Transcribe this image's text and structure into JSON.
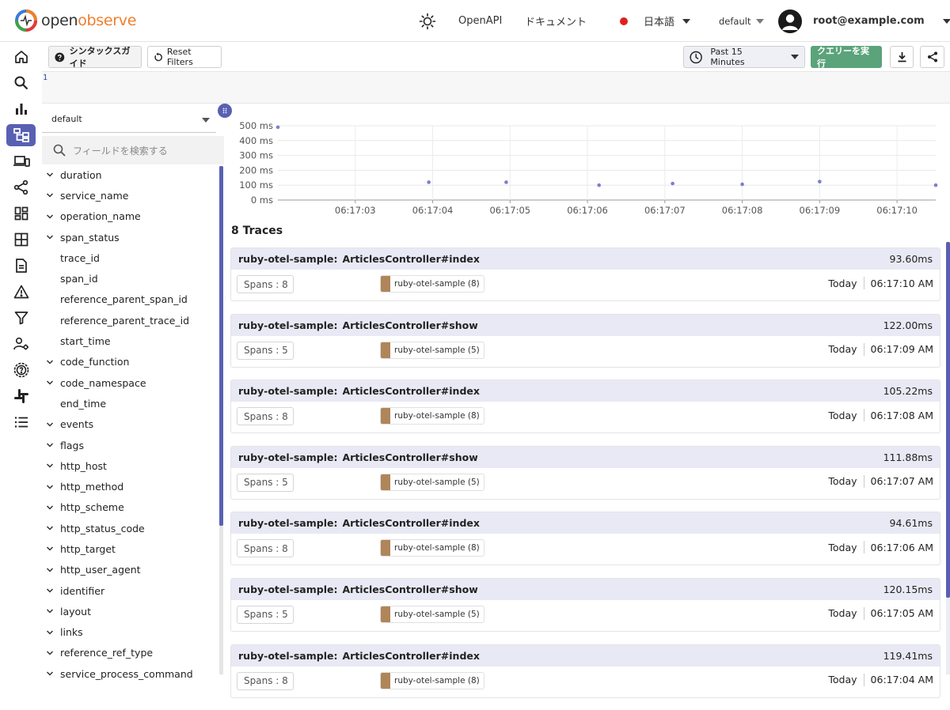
{
  "brand": {
    "logo_primary": "open",
    "logo_accent": "observe"
  },
  "header": {
    "openapi_label": "OpenAPI",
    "docs_label": "ドキュメント",
    "language_label": "日本語",
    "org_label": "default",
    "user_label": "root@example.com",
    "status_dot_color": "#e02020"
  },
  "sidenav": {
    "items": [
      {
        "name": "home-icon",
        "active": false
      },
      {
        "name": "search-icon",
        "active": false
      },
      {
        "name": "metrics-icon",
        "active": false
      },
      {
        "name": "traces-icon",
        "active": true
      },
      {
        "name": "rum-icon",
        "active": false
      },
      {
        "name": "pipeline-icon",
        "active": false
      },
      {
        "name": "dashboards-icon",
        "active": false
      },
      {
        "name": "streams-icon",
        "active": false
      },
      {
        "name": "reports-icon",
        "active": false
      },
      {
        "name": "alerts-icon",
        "active": false
      },
      {
        "name": "functions-icon",
        "active": false
      },
      {
        "name": "iam-icon",
        "active": false
      },
      {
        "name": "settings-icon",
        "active": false
      },
      {
        "name": "slack-icon",
        "active": false
      },
      {
        "name": "list-icon",
        "active": false
      }
    ]
  },
  "toolbar": {
    "syntax_guide_label": "シンタックスガイド",
    "reset_filters_label": "Reset Filters",
    "time_range_label": "Past 15 Minutes",
    "run_query_label": "クエリーを実行",
    "run_query_color": "#5ba37a"
  },
  "editor": {
    "line_number": "1"
  },
  "fields": {
    "stream_value": "default",
    "search_placeholder": "フィールドを検索する",
    "items": [
      {
        "label": "duration",
        "expandable": true
      },
      {
        "label": "service_name",
        "expandable": true
      },
      {
        "label": "operation_name",
        "expandable": true
      },
      {
        "label": "span_status",
        "expandable": true
      },
      {
        "label": "trace_id",
        "expandable": false
      },
      {
        "label": "span_id",
        "expandable": false
      },
      {
        "label": "reference_parent_span_id",
        "expandable": false
      },
      {
        "label": "reference_parent_trace_id",
        "expandable": false
      },
      {
        "label": "start_time",
        "expandable": false
      },
      {
        "label": "code_function",
        "expandable": true
      },
      {
        "label": "code_namespace",
        "expandable": true
      },
      {
        "label": "end_time",
        "expandable": false
      },
      {
        "label": "events",
        "expandable": true
      },
      {
        "label": "flags",
        "expandable": true
      },
      {
        "label": "http_host",
        "expandable": true
      },
      {
        "label": "http_method",
        "expandable": true
      },
      {
        "label": "http_scheme",
        "expandable": true
      },
      {
        "label": "http_status_code",
        "expandable": true
      },
      {
        "label": "http_target",
        "expandable": true
      },
      {
        "label": "http_user_agent",
        "expandable": true
      },
      {
        "label": "identifier",
        "expandable": true
      },
      {
        "label": "layout",
        "expandable": true
      },
      {
        "label": "links",
        "expandable": true
      },
      {
        "label": "reference_ref_type",
        "expandable": true
      },
      {
        "label": "service_process_command",
        "expandable": true
      }
    ]
  },
  "chart_data": {
    "type": "scatter",
    "title": "",
    "xlabel": "",
    "ylabel": "",
    "y_tick_labels": [
      "0 ms",
      "100 ms",
      "200 ms",
      "300 ms",
      "400 ms",
      "500 ms"
    ],
    "x_tick_labels": [
      "06:17:03",
      "06:17:04",
      "06:17:05",
      "06:17:06",
      "06:17:07",
      "06:17:08",
      "06:17:09",
      "06:17:10"
    ],
    "ylim": [
      0,
      500
    ],
    "xlim": [
      2.0,
      10.5
    ],
    "x": [
      2.0,
      3.95,
      4.95,
      6.15,
      7.1,
      8.0,
      9.0,
      10.5
    ],
    "values": [
      490,
      120,
      120,
      100,
      111,
      106,
      124,
      100
    ],
    "point_color": "#7a7fcc",
    "grid": true
  },
  "traces": {
    "count_label": "8 Traces",
    "items": [
      {
        "service": "ruby-otel-sample:",
        "operation": "ArticlesController#index",
        "duration": "93.60ms",
        "spans": "Spans : 8",
        "chip": "ruby-otel-sample (8)",
        "day": "Today",
        "time": "06:17:10 AM"
      },
      {
        "service": "ruby-otel-sample:",
        "operation": "ArticlesController#show",
        "duration": "122.00ms",
        "spans": "Spans : 5",
        "chip": "ruby-otel-sample (5)",
        "day": "Today",
        "time": "06:17:09 AM"
      },
      {
        "service": "ruby-otel-sample:",
        "operation": "ArticlesController#index",
        "duration": "105.22ms",
        "spans": "Spans : 8",
        "chip": "ruby-otel-sample (8)",
        "day": "Today",
        "time": "06:17:08 AM"
      },
      {
        "service": "ruby-otel-sample:",
        "operation": "ArticlesController#show",
        "duration": "111.88ms",
        "spans": "Spans : 5",
        "chip": "ruby-otel-sample (5)",
        "day": "Today",
        "time": "06:17:07 AM"
      },
      {
        "service": "ruby-otel-sample:",
        "operation": "ArticlesController#index",
        "duration": "94.61ms",
        "spans": "Spans : 8",
        "chip": "ruby-otel-sample (8)",
        "day": "Today",
        "time": "06:17:06 AM"
      },
      {
        "service": "ruby-otel-sample:",
        "operation": "ArticlesController#show",
        "duration": "120.15ms",
        "spans": "Spans : 5",
        "chip": "ruby-otel-sample (5)",
        "day": "Today",
        "time": "06:17:05 AM"
      },
      {
        "service": "ruby-otel-sample:",
        "operation": "ArticlesController#index",
        "duration": "119.41ms",
        "spans": "Spans : 8",
        "chip": "ruby-otel-sample (8)",
        "day": "Today",
        "time": "06:17:04 AM"
      }
    ],
    "chip_color": "#b0855a"
  }
}
